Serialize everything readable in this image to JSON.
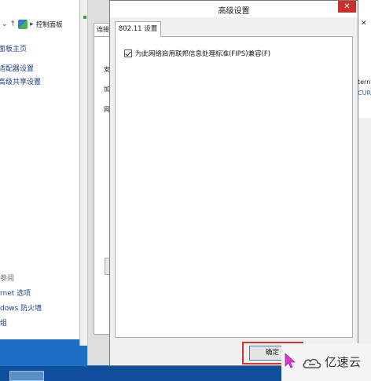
{
  "background_window": {
    "breadcrumb": "控制面板",
    "sidebar_top": [
      "面板主页",
      "适配器设置",
      "高级共享设置"
    ],
    "sidebar_bottom": [
      "参阅",
      "rnet 选项",
      "dows 防火墙",
      "组"
    ],
    "right_partial": [
      "tern",
      "CUR"
    ]
  },
  "middle_window": {
    "tab_label": "连接",
    "labels": [
      "安",
      "加",
      "网"
    ]
  },
  "dialog": {
    "title": "高级设置",
    "close_glyph": "✕",
    "tab_label": "802.11 设置",
    "fips_checkbox_label": "为此网络启用联邦信息处理标准(FIPS)兼容(F)",
    "fips_checked": true,
    "ok_label": "确定"
  },
  "watermark": {
    "text": "亿速云"
  },
  "colors": {
    "close_button": "#c7312b",
    "highlight_box": "#d9342b",
    "taskbar": "#1e6fc6",
    "cursor": "#d63ad3"
  }
}
